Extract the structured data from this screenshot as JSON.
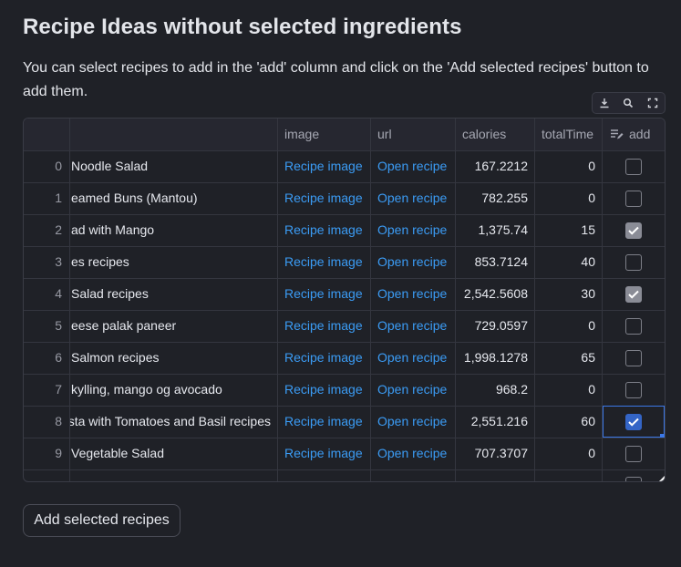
{
  "page": {
    "title": "Recipe Ideas without selected ingredients",
    "description": "You can select recipes to add in the 'add' column and click on the 'Add selected recipes' button to add them."
  },
  "toolbar": {
    "icons": [
      "download-icon",
      "search-icon",
      "fullscreen-icon"
    ]
  },
  "table": {
    "columns": [
      "",
      "",
      "image",
      "url",
      "calories",
      "totalTime",
      "add"
    ],
    "rows": [
      {
        "index": "0",
        "title": "Noodle Salad",
        "image": "Recipe image",
        "url": "Open recipe",
        "calories": "167.2212",
        "totalTime": "0",
        "add": false
      },
      {
        "index": "1",
        "title": "eamed Buns (Mantou)",
        "image": "Recipe image",
        "url": "Open recipe",
        "calories": "782.255",
        "totalTime": "0",
        "add": false
      },
      {
        "index": "2",
        "title": "ad with Mango",
        "image": "Recipe image",
        "url": "Open recipe",
        "calories": "1,375.74",
        "totalTime": "15",
        "add": true
      },
      {
        "index": "3",
        "title": "es recipes",
        "image": "Recipe image",
        "url": "Open recipe",
        "calories": "853.7124",
        "totalTime": "40",
        "add": false
      },
      {
        "index": "4",
        "title": "Salad recipes",
        "image": "Recipe image",
        "url": "Open recipe",
        "calories": "2,542.5608",
        "totalTime": "30",
        "add": true
      },
      {
        "index": "5",
        "title": "eese palak paneer",
        "image": "Recipe image",
        "url": "Open recipe",
        "calories": "729.0597",
        "totalTime": "0",
        "add": false
      },
      {
        "index": "6",
        "title": "Salmon recipes",
        "image": "Recipe image",
        "url": "Open recipe",
        "calories": "1,998.1278",
        "totalTime": "65",
        "add": false
      },
      {
        "index": "7",
        "title": "kylling, mango og avocado",
        "image": "Recipe image",
        "url": "Open recipe",
        "calories": "968.2",
        "totalTime": "0",
        "add": false
      },
      {
        "index": "8",
        "title": "sta with Tomatoes and Basil recipes",
        "image": "Recipe image",
        "url": "Open recipe",
        "calories": "2,551.216",
        "totalTime": "60",
        "add": true
      },
      {
        "index": "9",
        "title": "Vegetable Salad",
        "image": "Recipe image",
        "url": "Open recipe",
        "calories": "707.3707",
        "totalTime": "0",
        "add": false
      }
    ]
  },
  "actions": {
    "add_button": "Add selected recipes"
  },
  "colors": {
    "background": "#1f2127",
    "link": "#3b9cf5",
    "checked": "#8a8c96",
    "focus": "#3465c6"
  }
}
